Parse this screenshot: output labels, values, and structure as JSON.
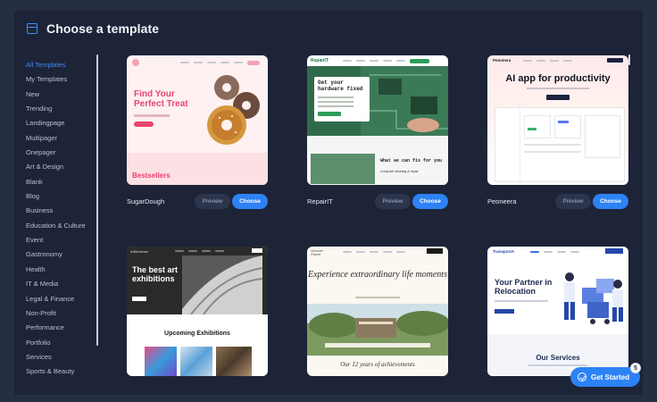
{
  "header": {
    "title": "Choose a template",
    "icon": "template-icon"
  },
  "sidebar": {
    "items": [
      {
        "label": "All Templates",
        "active": true
      },
      {
        "label": "My Templates"
      },
      {
        "label": "New"
      },
      {
        "label": "Trending"
      },
      {
        "label": "Landingpage"
      },
      {
        "label": "Multipager"
      },
      {
        "label": "Onepager"
      },
      {
        "label": "Art & Design"
      },
      {
        "label": "Blank"
      },
      {
        "label": "Blog"
      },
      {
        "label": "Business"
      },
      {
        "label": "Education & Culture"
      },
      {
        "label": "Event"
      },
      {
        "label": "Gastronomy"
      },
      {
        "label": "Health"
      },
      {
        "label": "IT & Media"
      },
      {
        "label": "Legal & Finance"
      },
      {
        "label": "Non-Profit"
      },
      {
        "label": "Performance"
      },
      {
        "label": "Portfolio"
      },
      {
        "label": "Services"
      },
      {
        "label": "Sports & Beauty"
      }
    ]
  },
  "cards": [
    {
      "name": "SugarDough",
      "preview_label": "Preview",
      "choose_label": "Choose",
      "thumb": {
        "headline": "Find Your Perfect Treat",
        "footer": "Bestsellers"
      }
    },
    {
      "name": "RepairIT",
      "preview_label": "Preview",
      "choose_label": "Choose",
      "thumb": {
        "logo": "RepairIT",
        "headline": "Get your hardware fixed",
        "sub": "What we can fix for you",
        "item": "Computer cleaning & repair"
      }
    },
    {
      "name": "Peoneera",
      "preview_label": "Preview",
      "choose_label": "Choose",
      "thumb": {
        "logo": "Peoneera",
        "headline": "AI app for productivity"
      }
    },
    {
      "thumb": {
        "logo": "ArtMuseum",
        "headline": "The best art exhibitions",
        "sub": "Upcoming Exhibitions"
      }
    },
    {
      "thumb": {
        "logo": "Wonder Planet",
        "headline": "Experience extraordinary life moments",
        "sub": "Our 12 years of achievements"
      }
    },
    {
      "thumb": {
        "logo": "TransportA",
        "headline": "Your Partner in Relocation",
        "sub": "Our Services"
      }
    }
  ],
  "floating": {
    "label": "Get Started",
    "badge": "5"
  },
  "colors": {
    "accent": "#2d82f5",
    "modal_bg": "#1d2438",
    "page_bg": "#262e42"
  }
}
